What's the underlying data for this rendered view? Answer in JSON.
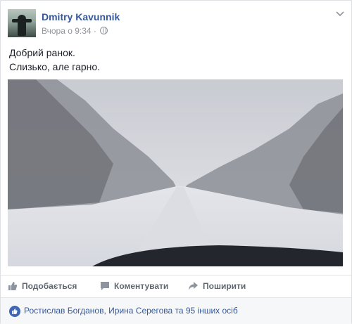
{
  "post": {
    "author": "Dmitry Kavunnik",
    "time": "Вчора о 9:34",
    "text_line1": "Добрий ранок.",
    "text_line2": "Слизько, але гарно.",
    "privacy_icon": "globe-icon",
    "menu_icon": "chevron-down-icon"
  },
  "actions": {
    "like": "Подобається",
    "comment": "Коментувати",
    "share": "Поширити"
  },
  "reactions": {
    "summary": "Ростислав Богданов, Ирина Серегова та 95 інших осіб"
  },
  "colors": {
    "link": "#365899",
    "accent": "#4267b2",
    "muted": "#90949c"
  }
}
